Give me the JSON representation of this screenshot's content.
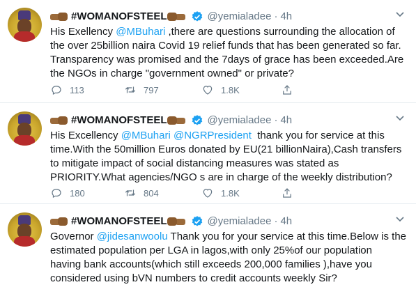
{
  "tweets": [
    {
      "name": "#WOMANOFSTEEL",
      "handle": "@yemialadee",
      "time": "4h",
      "lines": [
        [
          {
            "t": "His Exellency "
          },
          {
            "m": "@MBuhari"
          },
          {
            "t": " ,there are questions surrounding the allocation of"
          }
        ],
        [
          {
            "t": "the over 25billion naira Covid 19 relief funds that has been generated so far."
          }
        ],
        [
          {
            "t": "Transparency was promised and the 7days of grace has been exceeded.Are"
          }
        ],
        [
          {
            "t": "the NGOs in charge \"government owned\" or private?"
          }
        ]
      ],
      "replies": "113",
      "retweets": "797",
      "likes": "1.8K"
    },
    {
      "name": "#WOMANOFSTEEL",
      "handle": "@yemialadee",
      "time": "4h",
      "lines": [
        [
          {
            "t": "His Excellency "
          },
          {
            "m": "@MBuhari"
          },
          {
            "t": " "
          },
          {
            "m": "@NGRPresident"
          },
          {
            "t": "  thank you for service at this"
          }
        ],
        [
          {
            "t": "time.With the 50million Euros donated by EU(21 billionNaira),Cash transfers"
          }
        ],
        [
          {
            "t": "to mitigate impact of social distancing measures was stated as"
          }
        ],
        [
          {
            "t": "PRIORITY.What agencies/NGO s are in charge of the weekly distribution?"
          }
        ]
      ],
      "replies": "180",
      "retweets": "804",
      "likes": "1.8K"
    },
    {
      "name": "#WOMANOFSTEEL",
      "handle": "@yemialadee",
      "time": "4h",
      "lines": [
        [
          {
            "t": "Governor "
          },
          {
            "m": "@jidesanwoolu"
          },
          {
            "t": " Thank you for your service at this time.Below is the"
          }
        ],
        [
          {
            "t": "estimated population per LGA in lagos,with only 25%of our population"
          }
        ],
        [
          {
            "t": "having bank accounts(which still exceeds 200,000 families ),have you"
          }
        ],
        [
          {
            "t": "considered using bVN numbers to credit accounts weekly Sir?"
          }
        ]
      ]
    }
  ],
  "colors": {
    "accent": "#1da1f2",
    "text": "#14171a",
    "muted": "#657786",
    "divider": "#e6ecf0"
  },
  "icons": {
    "reply": "speech-bubble-icon",
    "retweet": "retweet-arrows-icon",
    "like": "heart-icon",
    "share": "share-upload-icon",
    "verified": "verified-badge-icon",
    "caret": "chevron-down-icon"
  }
}
